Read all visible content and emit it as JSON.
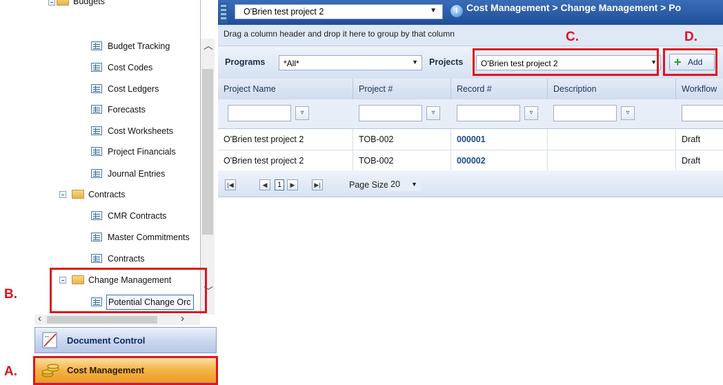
{
  "tree": {
    "items": [
      {
        "label": "Budgets",
        "type": "folder"
      },
      {
        "label": "Budget Tracking",
        "type": "doc"
      },
      {
        "label": "Cost Codes",
        "type": "doc"
      },
      {
        "label": "Cost Ledgers",
        "type": "doc"
      },
      {
        "label": "Forecasts",
        "type": "doc"
      },
      {
        "label": "Cost Worksheets",
        "type": "doc"
      },
      {
        "label": "Project Financials",
        "type": "doc"
      },
      {
        "label": "Journal Entries",
        "type": "doc"
      },
      {
        "label": "Contracts",
        "type": "folder"
      },
      {
        "label": "CMR Contracts",
        "type": "doc"
      },
      {
        "label": "Master Commitments",
        "type": "doc"
      },
      {
        "label": "Contracts",
        "type": "doc"
      },
      {
        "label": "Change Management",
        "type": "folder"
      },
      {
        "label": "Potential Change Orc",
        "type": "doc",
        "selected": true
      }
    ]
  },
  "nav": {
    "document_control": "Document Control",
    "cost_management": "Cost Management"
  },
  "toolbar": {
    "project": "O'Brien test project 2",
    "breadcrumb": "Cost Management > Change Management > Po"
  },
  "group_hint": "Drag a column header and drop it here to group by that column",
  "filters": {
    "programs_label": "Programs",
    "programs_value": "*All*",
    "projects_label": "Projects",
    "projects_value": "O'Brien test project 2",
    "add_label": "Add"
  },
  "grid": {
    "columns": [
      "Project Name",
      "Project #",
      "Record #",
      "Description",
      "Workflow"
    ],
    "rows": [
      [
        "O'Brien test project 2",
        "TOB-002",
        "000001",
        "",
        "Draft"
      ],
      [
        "O'Brien test project 2",
        "TOB-002",
        "000002",
        "",
        "Draft"
      ]
    ]
  },
  "pager": {
    "current_page": "1",
    "page_size_label": "Page Size",
    "page_size": "20"
  },
  "annotations": {
    "a": "A.",
    "b": "B.",
    "c": "C.",
    "d": "D."
  },
  "colors": {
    "annotation": "#e0141e",
    "header_blue": "#1f4f99",
    "active_nav_orange": "#f3b548"
  }
}
